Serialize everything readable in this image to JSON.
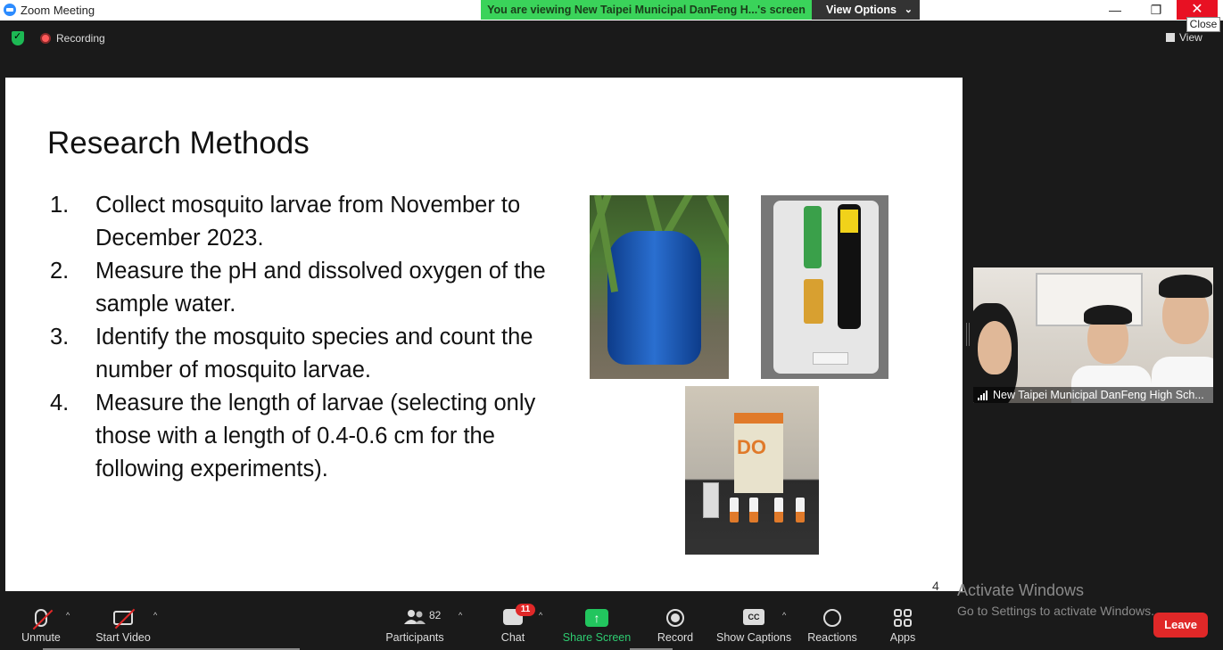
{
  "window": {
    "title": "Zoom Meeting",
    "viewing_banner": "You are viewing New Taipei Municipal DanFeng H...'s screen",
    "view_options_label": "View Options",
    "close_tooltip": "Close",
    "minimize_glyph": "—",
    "maximize_glyph": "❐",
    "close_glyph": "✕"
  },
  "meeting_bar": {
    "recording_label": "Recording",
    "view_label": "View"
  },
  "slide": {
    "title": "Research Methods",
    "items": [
      {
        "num": "1.",
        "text": "Collect mosquito larvae from November to December 2023."
      },
      {
        "num": "2.",
        "text": "Measure the pH and dissolved oxygen of the sample water."
      },
      {
        "num": "3.",
        "text": "Identify the mosquito species and count the number of mosquito larvae."
      },
      {
        "num": "4.",
        "text": "Measure the length of larvae (selecting only those with a length of 0.4-0.6 cm for the following experiments)."
      }
    ],
    "kit_label": "DO",
    "page_number": "4"
  },
  "participant": {
    "name": "New Taipei Municipal DanFeng High Sch..."
  },
  "toolbar": {
    "unmute": "Unmute",
    "start_video": "Start Video",
    "participants": "Participants",
    "participant_count": "82",
    "chat": "Chat",
    "chat_badge": "11",
    "share_screen": "Share Screen",
    "share_glyph": "↑",
    "record": "Record",
    "show_captions": "Show Captions",
    "cc_glyph": "CC",
    "reactions": "Reactions",
    "apps": "Apps",
    "leave": "Leave"
  },
  "watermark": {
    "title": "Activate Windows",
    "subtitle": "Go to Settings to activate Windows."
  }
}
